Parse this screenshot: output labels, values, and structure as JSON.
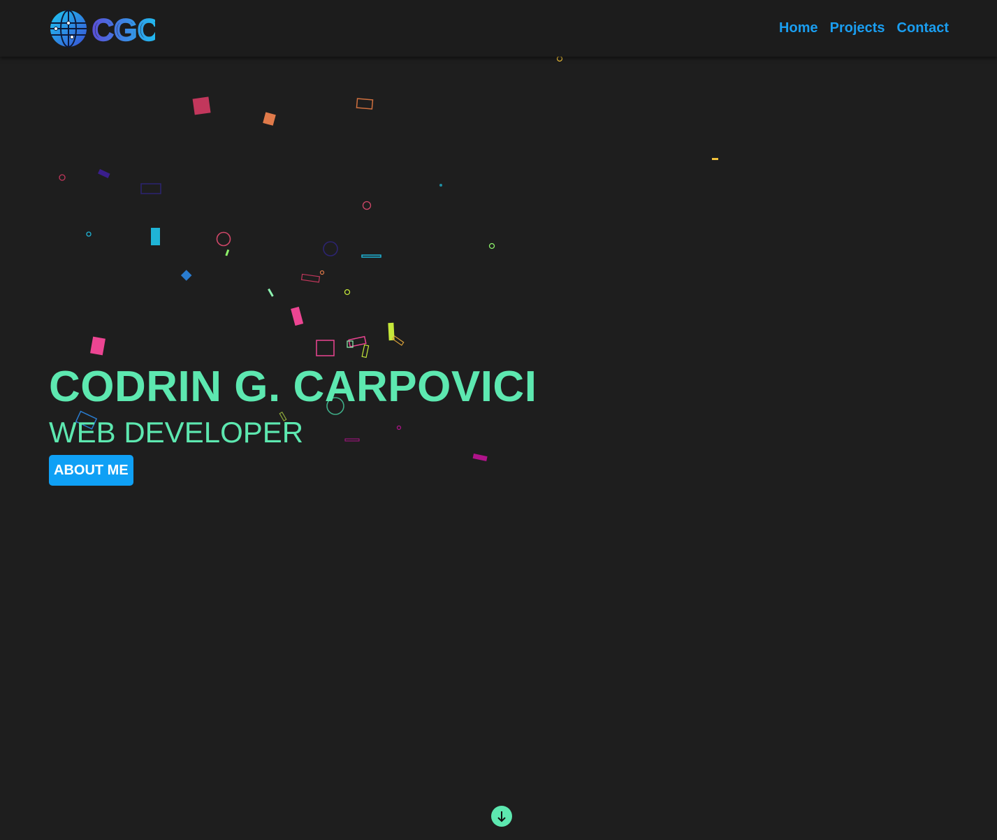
{
  "logo": {
    "text": "CGC",
    "icon": "globe-icon"
  },
  "nav": {
    "items": [
      {
        "label": "Home"
      },
      {
        "label": "Projects"
      },
      {
        "label": "Contact"
      }
    ]
  },
  "hero": {
    "name": "CODRIN G. CARPOVICI",
    "role": "WEB DEVELOPER",
    "cta_label": "ABOUT ME"
  },
  "scroll": {
    "icon": "arrow-down-icon"
  },
  "colors": {
    "background": "#1e1e1e",
    "accent_green": "#5de8b0",
    "accent_blue": "#0fa0f5",
    "nav_link": "#1a9ef0"
  }
}
